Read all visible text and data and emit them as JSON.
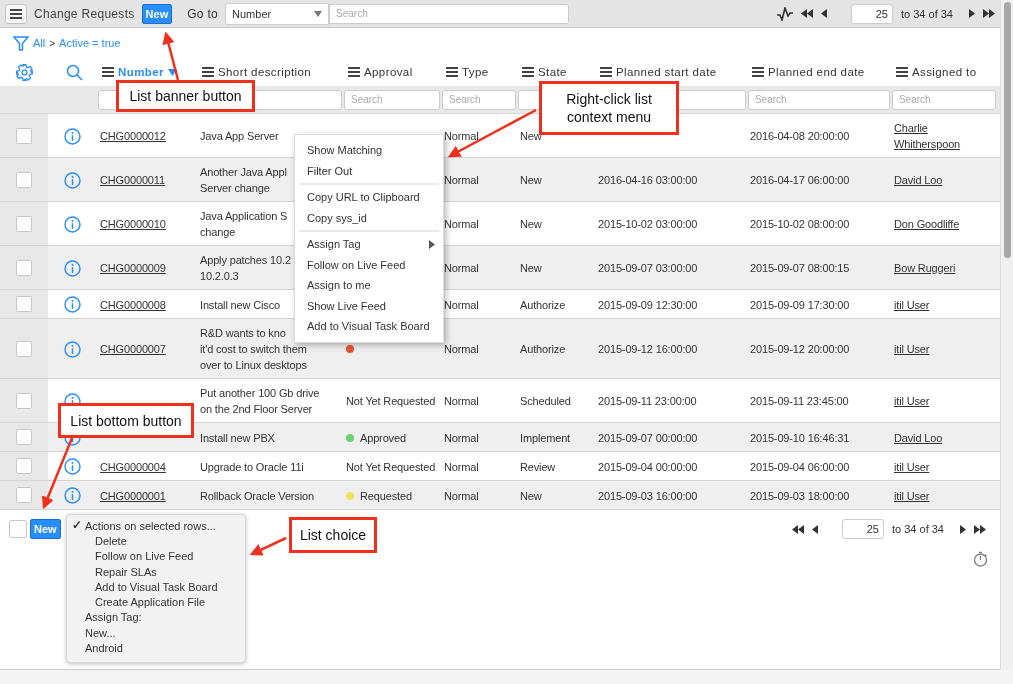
{
  "top_bar": {
    "title": "Change Requests",
    "new_button": "New",
    "goto_label": "Go to",
    "goto_field": "Number",
    "search": {
      "placeholder": "Search"
    },
    "pager": {
      "page": "25",
      "range": "to 34 of 34"
    }
  },
  "breadcrumb": {
    "all": "All",
    "separator": ">",
    "filter": "Active = true"
  },
  "columns": [
    {
      "label": "Number",
      "sorted": true
    },
    {
      "label": "Short description",
      "sorted": false
    },
    {
      "label": "Approval",
      "sorted": false
    },
    {
      "label": "Type",
      "sorted": false
    },
    {
      "label": "State",
      "sorted": false
    },
    {
      "label": "Planned start date",
      "sorted": false
    },
    {
      "label": "Planned end date",
      "sorted": false
    },
    {
      "label": "Assigned to",
      "sorted": false
    }
  ],
  "filter_row": [
    {
      "kind": "covered"
    },
    {
      "kind": "covered"
    },
    {
      "kind": "open",
      "placeholder": "Search"
    },
    {
      "kind": "open",
      "placeholder": "Search"
    },
    {
      "kind": "covered"
    },
    {
      "kind": "covered"
    },
    {
      "kind": "open",
      "placeholder": "Search"
    },
    {
      "kind": "open",
      "placeholder": "Search"
    }
  ],
  "rows": [
    {
      "checked": false,
      "number": "CHG0000012",
      "description": "Java App Server",
      "type": "Normal",
      "state": "New",
      "end": "2016-04-08 20:00:00",
      "assigned": "Charlie Whitherspoon"
    },
    {
      "checked": false,
      "number": "CHG0000011",
      "description": "Another Java Appl\nServer change",
      "type": "Normal",
      "state": "New",
      "start": "2016-04-16 03:00:00",
      "end": "2016-04-17 06:00:00",
      "assigned": "David Loo"
    },
    {
      "checked": false,
      "number": "CHG0000010",
      "description": "Java Application S\nchange",
      "type": "Normal",
      "state": "New",
      "start": "2015-10-02 03:00:00",
      "end": "2015-10-02 08:00:00",
      "assigned": "Don Goodliffe"
    },
    {
      "checked": false,
      "number": "CHG0000009",
      "description": "Apply patches 10.2\n10.2.0.3",
      "type": "Normal",
      "state": "New",
      "start": "2015-09-07 03:00:00",
      "end": "2015-09-07 08:00:15",
      "assigned": "Bow Ruggeri"
    },
    {
      "checked": false,
      "number": "CHG0000008",
      "description": "Install new Cisco",
      "type": "Normal",
      "state": "Authorize",
      "start": "2015-09-09 12:30:00",
      "end": "2015-09-09 17:30:00",
      "assigned": "itil User"
    },
    {
      "checked": false,
      "number": "CHG0000007",
      "description": "R&D wants to kno\nit'd cost to switch them\nover to Linux desktops",
      "approval": {
        "color": "#e8532f"
      },
      "type": "Normal",
      "state": "Authorize",
      "start": "2015-09-12 16:00:00",
      "end": "2015-09-12 20:00:00",
      "assigned": "itil User"
    },
    {
      "checked": false,
      "description": "Put another 100 Gb drive\non the 2nd Floor Server",
      "approval": {
        "label": "Not Yet Requested"
      },
      "type": "Normal",
      "state": "Scheduled",
      "start": "2015-09-11 23:00:00",
      "end": "2015-09-11 23:45:00",
      "assigned": "itil User"
    },
    {
      "checked": false,
      "description": "Install new PBX",
      "approval": {
        "label": "Approved",
        "color": "#6cd46c"
      },
      "type": "Normal",
      "state": "Implement",
      "start": "2015-09-07 00:00:00",
      "end": "2015-09-10 16:46:31",
      "assigned": "David Loo"
    },
    {
      "checked": false,
      "number": "CHG0000004",
      "description": "Upgrade to Oracle 11i",
      "approval": {
        "label": "Not Yet Requested"
      },
      "type": "Normal",
      "state": "Review",
      "start": "2015-09-04 00:00:00",
      "end": "2015-09-04 06:00:00",
      "assigned": "itil User"
    },
    {
      "checked": false,
      "number": "CHG0000001",
      "description": "Rollback Oracle Version",
      "approval": {
        "label": "Requested",
        "color": "#f2e35c"
      },
      "type": "Normal",
      "state": "New",
      "start": "2015-09-03 16:00:00",
      "end": "2015-09-03 18:00:00",
      "assigned": "itil User"
    }
  ],
  "footer": {
    "checked": false,
    "new_button": "New",
    "pager": {
      "page": "25",
      "range": "to 34 of 34"
    }
  },
  "list_choice": {
    "check_mark": "✓",
    "options": [
      {
        "label": "Actions on selected rows...",
        "selected": true,
        "children": [
          {
            "label": "Delete",
            "selected": false
          },
          {
            "label": "Follow on Live Feed",
            "selected": false
          },
          {
            "label": "Repair SLAs",
            "selected": false
          },
          {
            "label": "Add to Visual Task Board",
            "selected": false
          },
          {
            "label": "Create Application File",
            "selected": false
          }
        ]
      },
      {
        "label": "Assign Tag:",
        "selected": false
      },
      {
        "label": "New...",
        "selected": false
      },
      {
        "label": "Android",
        "selected": false
      }
    ]
  },
  "context_menu": [
    {
      "items": [
        {
          "label": "Show Matching",
          "submenu": false
        },
        {
          "label": "Filter Out",
          "submenu": false
        }
      ]
    },
    {
      "items": [
        {
          "label": "Copy URL to Clipboard",
          "submenu": false
        },
        {
          "label": "Copy sys_id",
          "submenu": false
        }
      ]
    },
    {
      "items": [
        {
          "label": "Assign Tag",
          "submenu": true
        },
        {
          "label": "Follow on Live Feed",
          "submenu": false
        },
        {
          "label": "Assign to me",
          "submenu": false
        },
        {
          "label": "Show Live Feed",
          "submenu": false
        },
        {
          "label": "Add to Visual Task Board",
          "submenu": false
        }
      ]
    }
  ],
  "callouts": [
    {
      "text": "List banner button"
    },
    {
      "text": "Right-click list context menu"
    },
    {
      "text": "List bottom button"
    },
    {
      "text": "List choice"
    }
  ]
}
